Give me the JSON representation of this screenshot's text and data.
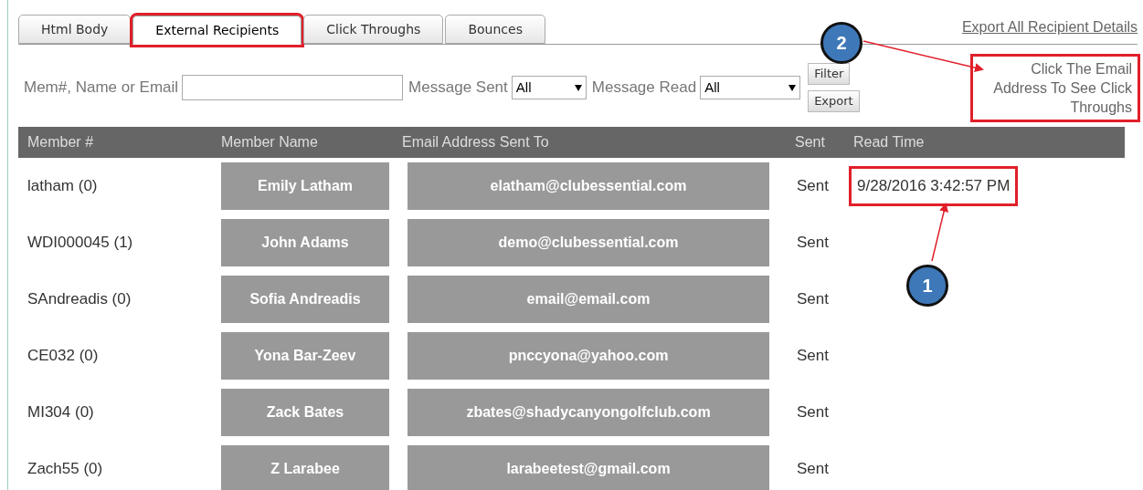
{
  "tabs": [
    {
      "label": "Html Body",
      "selected": false,
      "highlighted": false
    },
    {
      "label": "External Recipients",
      "selected": true,
      "highlighted": true
    },
    {
      "label": "Click Throughs",
      "selected": false,
      "highlighted": false
    },
    {
      "label": "Bounces",
      "selected": false,
      "highlighted": false
    }
  ],
  "export_link": "Export All Recipient Details",
  "filters": {
    "search_label": "Mem#, Name or Email",
    "sent_label": "Message Sent",
    "sent_value": "All",
    "read_label": "Message Read",
    "read_value": "All",
    "filter_button": "Filter",
    "export_button": "Export"
  },
  "help_text": {
    "text": "Click The Email Address To See Click Throughs",
    "highlighted": true
  },
  "table": {
    "columns": [
      "Member #",
      "Member Name",
      "Email Address Sent To",
      "Sent",
      "Read Time"
    ],
    "rows": [
      {
        "member": "latham (0)",
        "name": "Emily Latham",
        "email": "elatham@clubessential.com",
        "sent": "Sent",
        "read_time": "9/28/2016 3:42:57 PM",
        "highlighted": true
      },
      {
        "member": "WDI000045 (1)",
        "name": "John Adams",
        "email": "demo@clubessential.com",
        "sent": "Sent"
      },
      {
        "member": "SAndreadis (0)",
        "name": "Sofia Andreadis",
        "email": "email@email.com",
        "sent": "Sent"
      },
      {
        "member": "CE032 (0)",
        "name": "Yona Bar-Zeev",
        "email": "pnccyona@yahoo.com",
        "sent": "Sent"
      },
      {
        "member": "MI304 (0)",
        "name": "Zack Bates",
        "email": "zbates@shadycanyongolfclub.com",
        "sent": "Sent"
      },
      {
        "member": "Zach55 (0)",
        "name": "Z Larabee",
        "email": "larabeetest@gmail.com",
        "sent": "Sent"
      }
    ]
  },
  "callouts": [
    "1",
    "2"
  ]
}
